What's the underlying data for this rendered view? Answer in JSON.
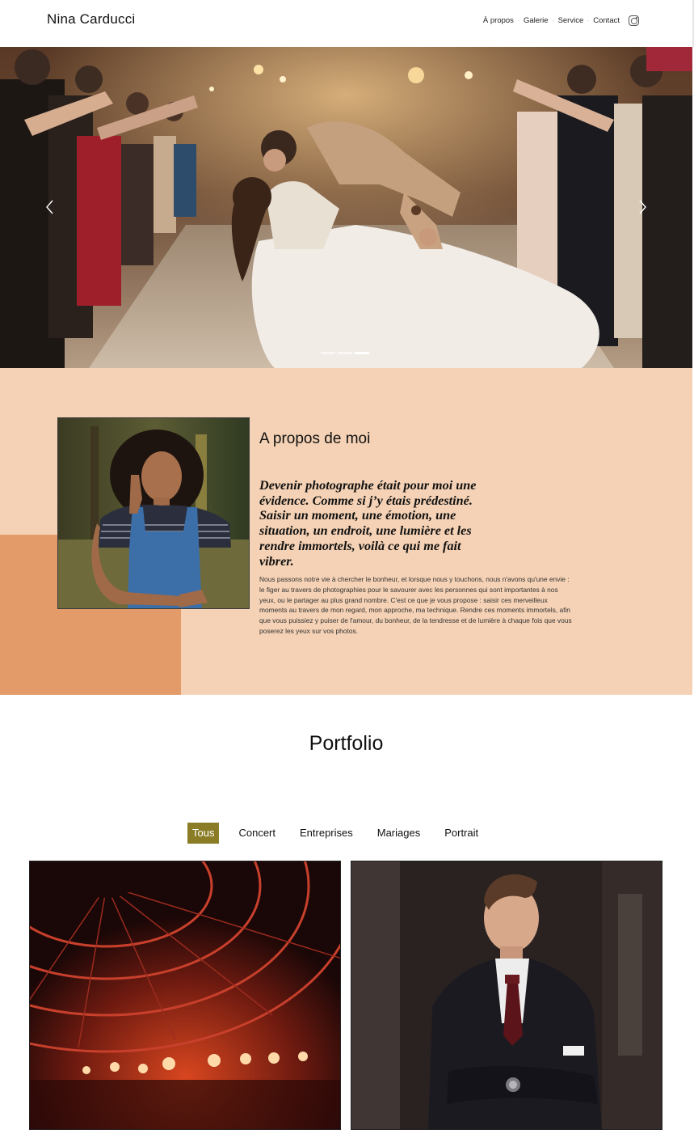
{
  "header": {
    "brand": "Nina Carducci",
    "nav": [
      {
        "label": "À propos"
      },
      {
        "label": "Galerie"
      },
      {
        "label": "Service"
      },
      {
        "label": "Contact"
      }
    ],
    "social_icon": "instagram-icon"
  },
  "hero": {
    "image": "wedding-couple-kiss-sparklers",
    "prev_icon": "chevron-left-icon",
    "next_icon": "chevron-right-icon",
    "slides": 3,
    "active_slide": 3
  },
  "about": {
    "title": "A propos de moi",
    "quote": "Devenir photographe était pour moi une évidence. Comme si j’y étais prédestiné. Saisir un moment, une émotion, une situation, un endroit, une lumière et les rendre immortels, voilà ce qui me fait vibrer.",
    "text": "Nous passons notre vie à chercher le bonheur, et lorsque nous y touchons, nous n'avons qu'une envie : le figer au travers de photographies pour le savourer avec les personnes qui sont importantes à nos yeux, ou le partager au plus grand nombre. C'est ce que je vous propose : saisir ces merveilleux moments au travers de mon regard, mon approche, ma technique. Rendre ces moments immortels, afin que vous puissiez y puiser de l'amour, du bonheur, de la tendresse et de lumière à chaque fois que vous poserez les yeux sur vos photos.",
    "image": "portrait-woman-denim-overalls"
  },
  "portfolio": {
    "title": "Portfolio",
    "filters": [
      "Tous",
      "Concert",
      "Entreprises",
      "Mariages",
      "Portrait"
    ],
    "active_filter": "Tous",
    "items": [
      {
        "image": "concert-stage-lights"
      },
      {
        "image": "businessman-in-suit"
      }
    ]
  },
  "colors": {
    "about_bg": "#f5d2b5",
    "about_accent": "#e39b69",
    "filter_active": "#8b7d26"
  }
}
